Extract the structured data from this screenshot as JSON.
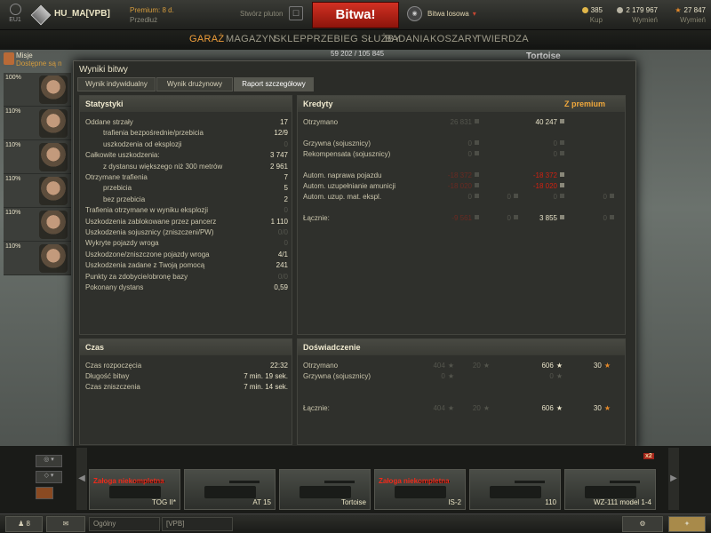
{
  "topbar": {
    "server": "EU1",
    "player": "HU_MA[VPB]",
    "premium_label": "Premium: 8 d.",
    "premium_extend": "Przedłuż",
    "platoon_label": "Stwórz pluton",
    "battle_button": "Bitwa!",
    "battle_mode": "Bitwa losowa",
    "gold": {
      "value": "385",
      "sub": "Kup"
    },
    "credits": {
      "value": "2 179 967",
      "sub": "Wymień"
    },
    "free_xp": {
      "value": "27 847",
      "sub": "Wymień"
    }
  },
  "nav": {
    "items": [
      "GARAŻ",
      "MAGAZYN",
      "SKLEP",
      "PRZEBIEG SŁUŻBY",
      "BADANIA",
      "KOSZARY",
      "TWIERDZA"
    ],
    "active": "GARAŻ"
  },
  "missions": {
    "title": "Misje",
    "status": "Dostępne są n"
  },
  "crew": {
    "percents": [
      "100%",
      "110%",
      "110%",
      "110%",
      "110%",
      "110%"
    ]
  },
  "tank_title": "Tortoise",
  "xp_strip": "59 202 / 105 845",
  "modal": {
    "title": "Wyniki bitwy",
    "tabs": [
      "Wynik indywidualny",
      "Wynik drużynowy",
      "Raport szczegółowy"
    ],
    "active_tab": "Raport szczegółowy",
    "stats": {
      "header": "Statystyki",
      "rows": [
        {
          "label": "Oddane strzały",
          "value": "17",
          "indent": false,
          "dim": false
        },
        {
          "label": "trafienia bezpośrednie/przebicia",
          "value": "12/9",
          "indent": true,
          "dim": false
        },
        {
          "label": "uszkodzenia od eksplozji",
          "value": "0",
          "indent": true,
          "dim": true
        },
        {
          "label": "Całkowite uszkodzenia:",
          "value": "3 747",
          "indent": false,
          "dim": false
        },
        {
          "label": "z dystansu większego niż 300 metrów",
          "value": "2 961",
          "indent": true,
          "dim": false
        },
        {
          "label": "Otrzymane trafienia",
          "value": "7",
          "indent": false,
          "dim": false
        },
        {
          "label": "przebicia",
          "value": "5",
          "indent": true,
          "dim": false
        },
        {
          "label": "bez przebicia",
          "value": "2",
          "indent": true,
          "dim": false
        },
        {
          "label": "Trafienia otrzymane w wyniku eksplozji",
          "value": "0",
          "indent": false,
          "dim": true
        },
        {
          "label": "Uszkodzenia zablokowane przez pancerz",
          "value": "1 110",
          "indent": false,
          "dim": false
        },
        {
          "label": "Uszkodzenia sojusznicy (zniszczeni/PW)",
          "value": "0/0",
          "indent": false,
          "dim": true
        },
        {
          "label": "Wykryte pojazdy wroga",
          "value": "0",
          "indent": false,
          "dim": true
        },
        {
          "label": "Uszkodzone/zniszczone pojazdy wroga",
          "value": "4/1",
          "indent": false,
          "dim": false
        },
        {
          "label": "Uszkodzenia zadane z Twoją pomocą",
          "value": "241",
          "indent": false,
          "dim": false
        },
        {
          "label": "Punkty za zdobycie/obronę bazy",
          "value": "0/0",
          "indent": false,
          "dim": true
        },
        {
          "label": "Pokonany dystans",
          "value": "0,59",
          "indent": false,
          "dim": false
        }
      ]
    },
    "credits": {
      "header": "Kredyty",
      "premium_header": "Z premium",
      "rows": [
        {
          "label": "Otrzymano",
          "basic": "26 831",
          "basic_cls": "dim",
          "prem": "40 247",
          "prem_cls": ""
        },
        {
          "label": "Grzywna (sojusznicy)",
          "basic": "0",
          "basic_cls": "dim",
          "prem": "0",
          "prem_cls": "dim"
        },
        {
          "label": "Rekompensata (sojusznicy)",
          "basic": "0",
          "basic_cls": "dim",
          "prem": "0",
          "prem_cls": "dim"
        },
        {
          "label": "Autom. naprawa pojazdu",
          "basic": "-18 372",
          "basic_cls": "dimred",
          "prem": "-18 372",
          "prem_cls": "red"
        },
        {
          "label": "Autom. uzupełnianie amunicji",
          "basic": "-18 020",
          "basic_cls": "dimred",
          "prem": "-18 020",
          "prem_cls": "red"
        },
        {
          "label": "Autom. uzup. mat. ekspl.",
          "basic": "0",
          "basic_cls": "dim",
          "basic_gold": "0",
          "prem": "0",
          "prem_cls": "dim",
          "prem_gold": "0"
        },
        {
          "label": "Łącznie:",
          "basic": "-9 561",
          "basic_cls": "dimred",
          "basic_gold": "0",
          "prem": "3 855",
          "prem_cls": "",
          "prem_gold": "0"
        }
      ]
    },
    "time": {
      "header": "Czas",
      "rows": [
        {
          "label": "Czas rozpoczęcia",
          "value": "22:32"
        },
        {
          "label": "Długość bitwy",
          "value": "7 min. 19 sek."
        },
        {
          "label": "Czas zniszczenia",
          "value": "7 min. 14 sek."
        }
      ]
    },
    "experience": {
      "header": "Doświadczenie",
      "rows": [
        {
          "label": "Otrzymano",
          "xp": "404",
          "free": "20",
          "pxp": "606",
          "pfree": "30"
        },
        {
          "label": "Grzywna (sojusznicy)",
          "xp": "0",
          "free": "",
          "pxp": "0",
          "pfree": ""
        },
        {
          "label": "Łącznie:",
          "xp": "404",
          "free": "20",
          "pxp": "606",
          "pfree": "30"
        }
      ]
    }
  },
  "carousel": {
    "tanks": [
      {
        "name": "TOG II*",
        "warn": "Załoga niekompletna"
      },
      {
        "name": "AT 15",
        "warn": ""
      },
      {
        "name": "Tortoise",
        "warn": ""
      },
      {
        "name": "IS-2",
        "warn": "Załoga niekompletna"
      },
      {
        "name": "110",
        "warn": ""
      },
      {
        "name": "WZ-111 model 1-4",
        "warn": ""
      }
    ],
    "bonus": "x2"
  },
  "bottombar": {
    "platoon_count": "8",
    "channel_general": "Ogólny",
    "channel_clan": "[VPB]"
  },
  "colors": {
    "accent": "#ef9e3a",
    "battle": "#c1271b",
    "negative": "#d02010"
  }
}
